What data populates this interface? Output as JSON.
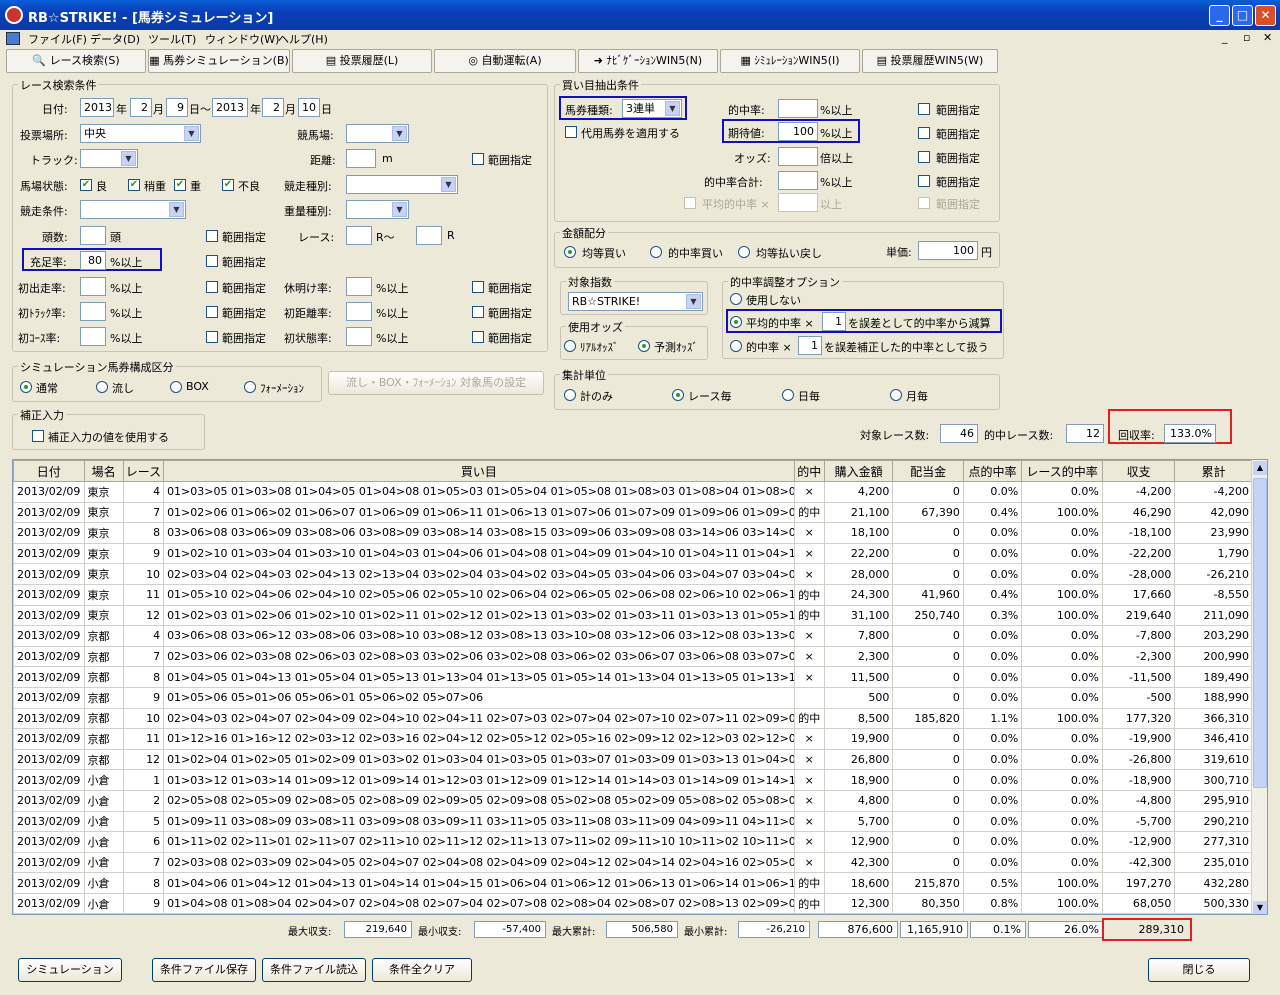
{
  "window": {
    "title": "RB☆STRIKE! - [馬券シミュレーション]",
    "btns": [
      "_",
      "□",
      "✕"
    ],
    "mdi": [
      "_",
      "▫",
      "✕"
    ]
  },
  "menu": [
    "ファイル(F)",
    "データ(D)",
    "ツール(T)",
    "ウィンドウ(W)",
    "ヘルプ(H)"
  ],
  "toolbar": [
    "レース検索(S)",
    "馬券シミュレーション(B)",
    "投票履歴(L)",
    "自動運転(A)",
    "ﾅﾋﾞｹﾞｰｼｮﾝWIN5(N)",
    "ｼﾐｭﾚｰｼｮﾝWIN5(I)",
    "投票履歴WIN5(W)"
  ],
  "race": {
    "legend": "レース検索条件",
    "date_label": "日付:",
    "y1": "2013",
    "y_unit": "年",
    "m1": "2",
    "m_unit": "月",
    "d1": "9",
    "d_unit_range": "日～",
    "y2": "2013",
    "m2": "2",
    "d2": "10",
    "d_unit": "日",
    "venue_label": "投票場所:",
    "venue": "中央",
    "course_label": "競馬場:",
    "track_label": "トラック:",
    "dist_label": "距離:",
    "dist_unit": "m",
    "range": "範囲指定",
    "cond_label": "馬場状態:",
    "conds": [
      "良",
      "稍重",
      "重",
      "不良"
    ],
    "type_label": "競走種別:",
    "rule_label": "競走条件:",
    "weight_label": "重量種別:",
    "heads_label": "頭数:",
    "heads_unit": "頭",
    "race_label": "レース:",
    "race_unit": "R～",
    "race_unit2": "R",
    "fill_label": "充足率:",
    "fill": "80",
    "over": "%以上",
    "f1": "初出走率:",
    "f2": "休明け率:",
    "f3": "初ﾄﾗｯｸ率:",
    "f4": "初距離率:",
    "f5": "初ｺｰｽ率:",
    "f6": "初状態率:"
  },
  "sim": {
    "legend": "シミュレーション馬券構成区分",
    "opts": [
      "通常",
      "流し",
      "BOX",
      "ﾌｫｰﾒｰｼｮﾝ"
    ],
    "btn": "流し・BOX・ﾌｫｰﾒｰｼｮﾝ 対象馬の設定"
  },
  "corr": {
    "legend": "補正入力",
    "chk": "補正入力の値を使用する"
  },
  "buy": {
    "legend": "買い目抽出条件",
    "kind_label": "馬券種類:",
    "kind": "3連単",
    "sub": "代用馬券を適用する",
    "hit_label": "的中率:",
    "ev_label": "期待値:",
    "ev": "100",
    "odds_label": "オッズ:",
    "odds_unit": "倍以上",
    "hitsum_label": "的中率合計:",
    "avg_label": "平均的中率 ×",
    "over": "%以上",
    "over2": "以上",
    "range": "範囲指定"
  },
  "money": {
    "legend": "金額配分",
    "opts": [
      "均等買い",
      "的中率買い",
      "均等払い戻し"
    ],
    "unit_label": "単価:",
    "unit": "100",
    "yen": "円"
  },
  "index": {
    "legend": "対象指数",
    "value": "RB☆STRIKE!"
  },
  "odds": {
    "legend": "使用オッズ",
    "opts": [
      "ﾘｱﾙｵｯｽﾞ",
      "予測ｵｯｽﾞ"
    ]
  },
  "adj": {
    "legend": "的中率調整オプション",
    "o1": "使用しない",
    "o2": "平均的中率 ×",
    "v2": "1",
    "t2": "を誤差として的中率から減算",
    "o3": "的中率 ×",
    "v3": "1",
    "t3": "を誤差補正した的中率として扱う"
  },
  "agg": {
    "legend": "集計単位",
    "opts": [
      "計のみ",
      "レース毎",
      "日毎",
      "月毎"
    ]
  },
  "stats": {
    "races_label": "対象レース数:",
    "races": "46",
    "hits_label": "的中レース数:",
    "hits": "12",
    "rr_label": "回収率:",
    "rr": "133.0%"
  },
  "table": {
    "headers": [
      "日付",
      "場名",
      "レース",
      "買い目",
      "的中",
      "購入金額",
      "配当金",
      "点的中率",
      "レース的中率",
      "収支",
      "累計"
    ],
    "rows": [
      [
        "2013/02/09",
        "東京",
        "4",
        "01>03>05 01>03>08 01>04>05 01>04>08 01>05>03 01>05>04 01>05>08 01>08>03 01>08>04 01>08>05 03>05>08 03>08>05 04",
        "×",
        "4,200",
        "0",
        "0.0%",
        "0.0%",
        "-4,200",
        "-4,200"
      ],
      [
        "2013/02/09",
        "東京",
        "7",
        "01>02>06 01>06>02 01>06>07 01>06>09 01>06>11 01>06>13 01>07>06 01>07>09 01>09>06 01>09>07 01>11>06 01>13>06 02",
        "的中",
        "21,100",
        "67,390",
        "0.4%",
        "100.0%",
        "46,290",
        "42,090"
      ],
      [
        "2013/02/09",
        "東京",
        "8",
        "03>06>08 03>06>09 03>08>06 03>08>09 03>08>14 03>08>15 03>09>06 03>09>08 03>14>06 03>14>08 03>15>08 04>06>08 04",
        "×",
        "18,100",
        "0",
        "0.0%",
        "0.0%",
        "-18,100",
        "23,990"
      ],
      [
        "2013/02/09",
        "東京",
        "9",
        "01>02>10 01>03>04 01>03>10 01>04>03 01>04>06 01>04>08 01>04>09 01>04>10 01>04>11 01>04>12 01>04>13 01>06>04 01",
        "×",
        "22,200",
        "0",
        "0.0%",
        "0.0%",
        "-22,200",
        "1,790"
      ],
      [
        "2013/02/09",
        "東京",
        "10",
        "02>03>04 02>04>03 02>04>13 02>13>04 03>02>04 03>04>02 03>04>05 03>04>06 03>04>07 03>04>08 03>04>09 03>04>10 03",
        "×",
        "28,000",
        "0",
        "0.0%",
        "0.0%",
        "-28,000",
        "-26,210"
      ],
      [
        "2013/02/09",
        "東京",
        "11",
        "01>05>10 02>04>06 02>04>10 02>05>06 02>05>10 02>06>04 02>06>05 02>06>08 02>06>10 02>06>12 02>06>15 02>08>10 02",
        "的中",
        "24,300",
        "41,960",
        "0.4%",
        "100.0%",
        "17,660",
        "-8,550"
      ],
      [
        "2013/02/09",
        "東京",
        "12",
        "01>02>03 01>02>06 01>02>10 01>02>11 01>02>12 01>02>13 01>03>02 01>03>11 01>03>13 01>05>11 01>06>02 01>06>11 01",
        "的中",
        "31,100",
        "250,740",
        "0.3%",
        "100.0%",
        "219,640",
        "211,090"
      ],
      [
        "2013/02/09",
        "京都",
        "4",
        "03>06>08 03>06>12 03>08>06 03>08>10 03>08>12 03>08>13 03>10>08 03>12>06 03>12>08 03>13>08 04>06>08 04>08>06 04",
        "×",
        "7,800",
        "0",
        "0.0%",
        "0.0%",
        "-7,800",
        "203,290"
      ],
      [
        "2013/02/09",
        "京都",
        "7",
        "02>03>06 02>03>08 02>06>03 02>08>03 03>02>06 03>02>08 03>06>02 03>06>07 03>06>08 03>07>06 03>08>02 03>08>06 04",
        "×",
        "2,300",
        "0",
        "0.0%",
        "0.0%",
        "-2,300",
        "200,990"
      ],
      [
        "2013/02/09",
        "京都",
        "8",
        "01>04>05 01>04>13 01>05>04 01>05>13 01>13>04 01>13>05 01>05>14 01>13>04 01>13>05 01>13>14 03>04>05 03>04>13 03",
        "×",
        "11,500",
        "0",
        "0.0%",
        "0.0%",
        "-11,500",
        "189,490"
      ],
      [
        "2013/02/09",
        "京都",
        "9",
        "01>05>06 05>01>06 05>06>01 05>06>02 05>07>06",
        "",
        "500",
        "0",
        "0.0%",
        "0.0%",
        "-500",
        "188,990"
      ],
      [
        "2013/02/09",
        "京都",
        "10",
        "02>04>03 02>04>07 02>04>09 02>04>10 02>04>11 02>07>03 02>07>04 02>07>10 02>07>11 02>09>04 02>10>04 02>10>07 02",
        "的中",
        "8,500",
        "185,820",
        "1.1%",
        "100.0%",
        "177,320",
        "366,310"
      ],
      [
        "2013/02/09",
        "京都",
        "11",
        "01>12>16 01>16>12 02>03>12 02>03>16 02>04>12 02>05>12 02>05>16 02>09>12 02>12>03 02>12>04 02>12>05 02>12>09 02",
        "×",
        "19,900",
        "0",
        "0.0%",
        "0.0%",
        "-19,900",
        "346,410"
      ],
      [
        "2013/02/09",
        "京都",
        "12",
        "01>02>04 01>02>05 01>02>09 01>03>02 01>03>04 01>03>05 01>03>07 01>03>09 01>03>13 01>04>02 01>04>03 01>04>05 01",
        "×",
        "26,800",
        "0",
        "0.0%",
        "0.0%",
        "-26,800",
        "319,610"
      ],
      [
        "2013/02/09",
        "小倉",
        "1",
        "01>03>12 01>03>14 01>09>12 01>09>14 01>12>03 01>12>09 01>12>14 01>14>03 01>14>09 01>14>12 03>01>09 03>01>12 03",
        "×",
        "18,900",
        "0",
        "0.0%",
        "0.0%",
        "-18,900",
        "300,710"
      ],
      [
        "2013/02/09",
        "小倉",
        "2",
        "02>05>08 02>05>09 02>08>05 02>08>09 02>09>05 02>09>08 05>02>08 05>02>09 05>08>02 05>08>09 05>09>02 05>09>08 05",
        "×",
        "4,800",
        "0",
        "0.0%",
        "0.0%",
        "-4,800",
        "295,910"
      ],
      [
        "2013/02/09",
        "小倉",
        "5",
        "01>09>11 03>08>09 03>08>11 03>09>08 03>09>11 03>11>05 03>11>08 03>11>09 04>09>11 04>11>09 05>08>11 05>09>08 05",
        "×",
        "5,700",
        "0",
        "0.0%",
        "0.0%",
        "-5,700",
        "290,210"
      ],
      [
        "2013/02/09",
        "小倉",
        "6",
        "01>11>02 02>11>01 02>11>07 02>11>10 02>11>12 02>11>13 07>11>02 09>11>10 10>11>02 10>11>09 11>01>02 11>01>03 11",
        "×",
        "12,900",
        "0",
        "0.0%",
        "0.0%",
        "-12,900",
        "277,310"
      ],
      [
        "2013/02/09",
        "小倉",
        "7",
        "02>03>08 02>03>09 02>04>05 02>04>07 02>04>08 02>04>09 02>04>12 02>04>14 02>04>16 02>05>04 02>05>07 02>05>08 02",
        "×",
        "42,300",
        "0",
        "0.0%",
        "0.0%",
        "-42,300",
        "235,010"
      ],
      [
        "2013/02/09",
        "小倉",
        "8",
        "01>04>06 01>04>12 01>04>13 01>04>14 01>04>15 01>06>04 01>06>12 01>06>13 01>06>14 01>06>15 01>12>04 01>12>06 01",
        "的中",
        "18,600",
        "215,870",
        "0.5%",
        "100.0%",
        "197,270",
        "432,280"
      ],
      [
        "2013/02/09",
        "小倉",
        "9",
        "01>04>08 01>08>04 02>04>07 02>04>08 02>07>04 02>07>08 02>08>04 02>08>07 02>08>13 02>09>04 02>09>08 02>13>08 02",
        "的中",
        "12,300",
        "80,350",
        "0.8%",
        "100.0%",
        "68,050",
        "500,330"
      ]
    ]
  },
  "summary": {
    "max_label": "最大収支:",
    "max": "219,640",
    "min_label": "最小収支:",
    "min": "-57,400",
    "maxcum_label": "最大累計:",
    "maxcum": "506,580",
    "mincum_label": "最小累計:",
    "mincum": "-26,210",
    "buy": "876,600",
    "pay": "1,165,910",
    "pt": "0.1%",
    "race": "26.0%",
    "total": "289,310"
  },
  "buttons": {
    "sim": "シミュレーション",
    "save": "条件ファイル保存",
    "load": "条件ファイル読込",
    "clear": "条件全クリア",
    "close": "閉じる"
  }
}
